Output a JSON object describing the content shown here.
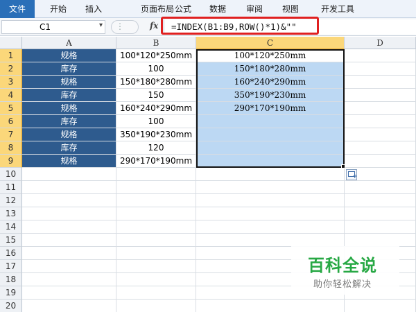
{
  "ribbon": {
    "tabs": [
      "文件",
      "开始",
      "插入",
      "页面布局",
      "公式",
      "数据",
      "审阅",
      "视图",
      "开发工具"
    ]
  },
  "formula_bar": {
    "name_box": "C1",
    "fx_label": "fx",
    "formula": "=INDEX(B1:B9,ROW()*1)&\"\""
  },
  "sheet": {
    "columns": [
      "A",
      "B",
      "C",
      "D"
    ],
    "rows": [
      "1",
      "2",
      "3",
      "4",
      "5",
      "6",
      "7",
      "8",
      "9",
      "10",
      "11",
      "12",
      "13",
      "14",
      "15",
      "16",
      "17",
      "18",
      "19",
      "20"
    ],
    "col_a": [
      "规格",
      "库存",
      "规格",
      "库存",
      "规格",
      "库存",
      "规格",
      "库存",
      "规格"
    ],
    "col_b": [
      "100*120*250mm",
      "100",
      "150*180*280mm",
      "150",
      "160*240*290mm",
      "100",
      "350*190*230mm",
      "120",
      "290*170*190mm"
    ],
    "col_c": [
      "100*120*250mm",
      "150*180*280mm",
      "160*240*290mm",
      "350*190*230mm",
      "290*170*190mm",
      "",
      "",
      "",
      ""
    ],
    "selected_column": "C",
    "selected_rows": "1-9"
  },
  "watermark": {
    "title": "百科全说",
    "subtitle": "助你轻松解决"
  },
  "colors": {
    "header_fill": "#2e5b8e",
    "selection_fill": "#bcd8f3",
    "highlight_box": "#e02020",
    "watermark_green": "#27a844"
  }
}
